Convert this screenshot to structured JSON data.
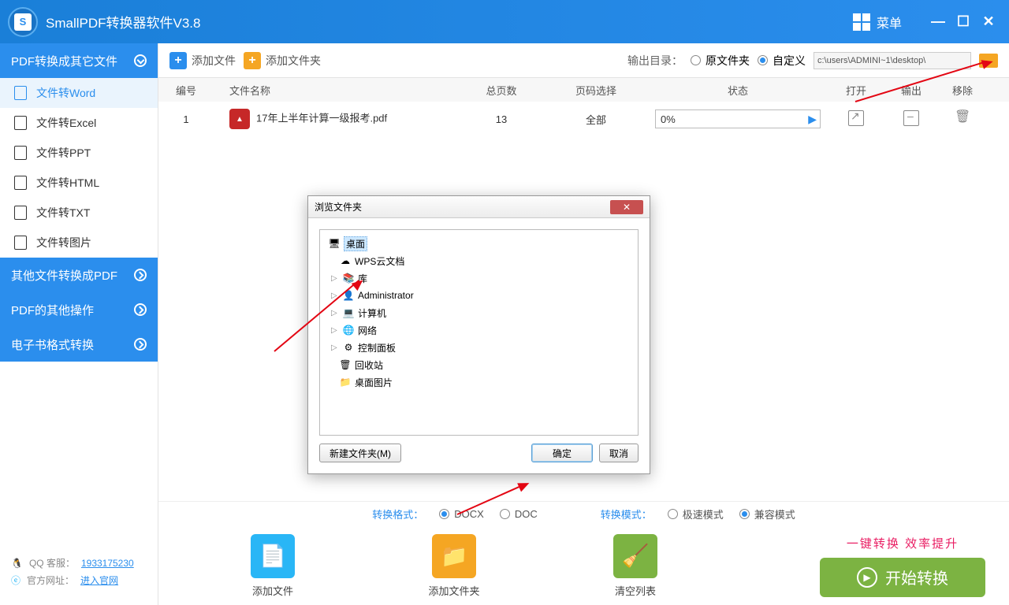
{
  "titlebar": {
    "app_name": "SmallPDF转换器软件V3.8",
    "menu": "菜单"
  },
  "sidebar": {
    "cat1": "PDF转换成其它文件",
    "items": [
      "文件转Word",
      "文件转Excel",
      "文件转PPT",
      "文件转HTML",
      "文件转TXT",
      "文件转图片"
    ],
    "cat2": "其他文件转换成PDF",
    "cat3": "PDF的其他操作",
    "cat4": "电子书格式转换",
    "qq_label": "QQ 客服：",
    "qq_num": "1933175230",
    "site_label": "官方网址：",
    "site_link": "进入官网"
  },
  "toolbar": {
    "add_file": "添加文件",
    "add_folder": "添加文件夹",
    "output_label": "输出目录：",
    "radio_src": "原文件夹",
    "radio_custom": "自定义",
    "path": "c:\\users\\ADMINI~1\\desktop\\"
  },
  "table": {
    "headers": {
      "num": "编号",
      "name": "文件名称",
      "pages": "总页数",
      "sel": "页码选择",
      "status": "状态",
      "open": "打开",
      "out": "输出",
      "del": "移除"
    },
    "row": {
      "num": "1",
      "name": "17年上半年计算一级报考.pdf",
      "pages": "13",
      "sel": "全部",
      "status": "0%"
    }
  },
  "dialog": {
    "title": "浏览文件夹",
    "items": [
      "桌面",
      "WPS云文档",
      "库",
      "Administrator",
      "计算机",
      "网络",
      "控制面板",
      "回收站",
      "桌面图片"
    ],
    "new_folder": "新建文件夹(M)",
    "ok": "确定",
    "cancel": "取消"
  },
  "bottom": {
    "fmt_label": "转换格式：",
    "fmt_docx": "DOCX",
    "fmt_doc": "DOC",
    "mode_label": "转换模式：",
    "mode_fast": "极速模式",
    "mode_compat": "兼容模式",
    "act_addfile": "添加文件",
    "act_addfolder": "添加文件夹",
    "act_clear": "清空列表",
    "promo": "一键转换  效率提升",
    "start": "开始转换"
  }
}
